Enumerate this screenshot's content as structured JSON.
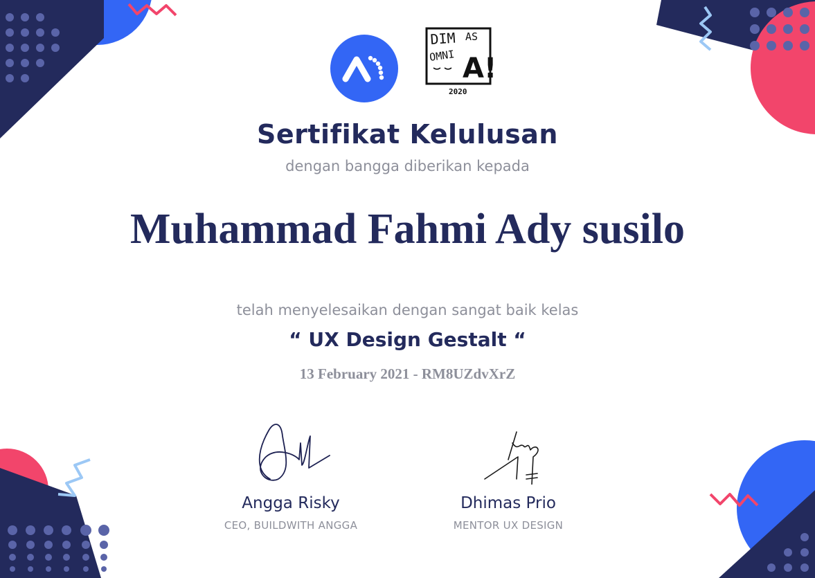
{
  "certificate": {
    "title": "Sertifikat Kelulusan",
    "subtitle": "dengan bangga diberikan kepada",
    "recipient_name": "Muhammad Fahmi Ady susilo",
    "completion_text": "telah menyelesaikan dengan sangat baik kelas",
    "course_name": "“ UX Design Gestalt “",
    "date_and_code": "13 February 2021 - RM8UZdvXrZ"
  },
  "logos": {
    "buildwith_angga": {
      "icon": "buildwith-angga-logo",
      "color": "#3366f5"
    },
    "dimas_omnia": {
      "line1": "DIM",
      "line1b": "AS",
      "line2": "OMNI",
      "big_letter": "A!",
      "year": "2020"
    }
  },
  "signatures": [
    {
      "name": "Angga Risky",
      "role": "CEO, BUILDWITH ANGGA"
    },
    {
      "name": "Dhimas Prio",
      "role": "MENTOR UX DESIGN"
    }
  ],
  "colors": {
    "navy": "#232a5c",
    "blue": "#3366f5",
    "pink": "#f2456b",
    "light_blue": "#9cc8f5",
    "gray": "#8d8f9a"
  }
}
